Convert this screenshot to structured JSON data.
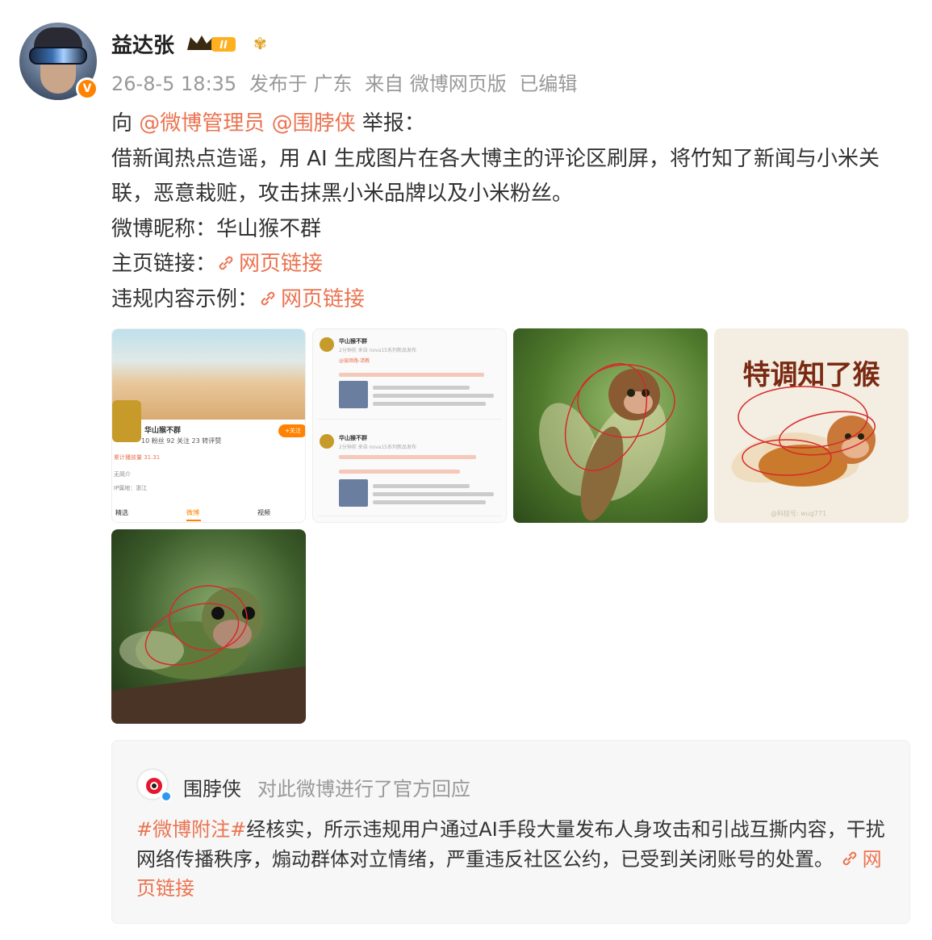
{
  "post": {
    "author": "益达张",
    "level_badge": "II",
    "meta": {
      "time": "26-8-5 18:35",
      "location": "发布于 广东",
      "source": "来自 微博网页版",
      "edited": "已编辑"
    },
    "lines": {
      "prefix": "向",
      "mention1": "@微博管理员",
      "mention2": "@围脖侠",
      "suffix": "举报：",
      "body": "借新闻热点造谣，用 AI 生成图片在各大博主的评论区刷屏，将竹知了新闻与小米关联，恶意栽赃，攻击抹黑小米品牌以及小米粉丝。",
      "nickname_label": "微博昵称：华山猴不群",
      "homepage_label": "主页链接：",
      "homepage_link": "网页链接",
      "example_label": "违规内容示例：",
      "example_link": "网页链接"
    }
  },
  "images": {
    "profile": {
      "name": "华山猴不群",
      "follow": "+关注",
      "stats": "10 粉丝    92 关注    23 转评赞",
      "tag": "累计播放量 31.31",
      "bio": "无简介",
      "loc": "IP属地：浙江",
      "tabs": [
        "精选",
        "微博",
        "视频"
      ]
    },
    "comments": {
      "user": "华山猴不群",
      "sub": "2分钟前 来自 nova15系列新品发布",
      "reply_tag": "@骏顺路-请教"
    },
    "cicada_text": "特调知了猴",
    "cicada_wm": "@科技号: wug771"
  },
  "repost": {
    "name": "围脖侠",
    "action": "对此微博进行了官方回应",
    "hashtag": "#微博附注#",
    "body": "经核实，所示违规用户通过AI手段大量发布人身攻击和引战互撕内容，干扰网络传播秩序，煽动群体对立情绪，严重违反社区公约，已受到关闭账号的处置。",
    "link": "网页链接"
  },
  "colors": {
    "accent": "#eb7350",
    "meta": "#999999",
    "vip": "#ff8200"
  }
}
